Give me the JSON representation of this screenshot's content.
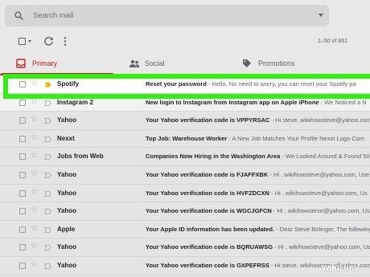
{
  "search": {
    "placeholder": "Search mail"
  },
  "toolbar": {
    "pager": "1–50 of 861"
  },
  "tabs": [
    {
      "label": "Primary",
      "icon": "inbox-icon",
      "active": true
    },
    {
      "label": "Social",
      "icon": "people-icon",
      "active": false
    },
    {
      "label": "Promotions",
      "icon": "tag-icon",
      "active": false
    }
  ],
  "emails": [
    {
      "sender": "Spotify",
      "subject": "Reset your password",
      "snippet": " - Hello. No need to worry, you can reset your Spotify pa",
      "important": true
    },
    {
      "sender": "Instagram 2",
      "subject": "New login to Instagram from Instagram app on Apple iPhone",
      "snippet": " - We Noticed a N",
      "important": false
    },
    {
      "sender": "Yahoo",
      "subject": "Your Yahoo verification code is VPPYRSAC",
      "snippet": " - Hi steve, wikihowsteve@yahoo.com",
      "important": false
    },
    {
      "sender": "Nexxt",
      "subject": "Top Job: Warehouse Worker",
      "snippet": " - A New Job Matches Your Profile Nexxt Logo Com",
      "important": false
    },
    {
      "sender": "Jobs from Web",
      "subject": "Companies Now Hiring in the Washington Area",
      "snippet": " - We Looked Around & Found 500",
      "important": false
    },
    {
      "sender": "Yahoo",
      "subject": "Your Yahoo verification code is FJAFFXBK",
      "snippet": " - Hi , wikihowsteve@yahoo.com, Use",
      "important": false
    },
    {
      "sender": "Yahoo",
      "subject": "Your Yahoo verification code is HVFZDCXN",
      "snippet": " - Hi , wikihowsteve@yahoo.com, Us",
      "important": false
    },
    {
      "sender": "Yahoo",
      "subject": "Your Yahoo verification code is WGCJGFCN",
      "snippet": " - Hi , wikihowsteve@yahoo.com, Us",
      "important": false
    },
    {
      "sender": "Apple",
      "subject": "Your Apple ID information has been updated.",
      "snippet": " - Dear Steve Bolinger, The following",
      "important": false
    },
    {
      "sender": "Yahoo",
      "subject": "Your Yahoo verification code is BQRUAWSG",
      "snippet": " - Hi , wikihowsteve@yahoo.com, Use",
      "important": false
    },
    {
      "sender": "Yahoo",
      "subject": "Your Yahoo verification code is GXPEFRSS",
      "snippet": " - Hi steve, wikihowsteve@yahoo.com",
      "important": false
    }
  ],
  "watermark": {
    "wiki": "wiki",
    "how": "How"
  },
  "colors": {
    "accent": "#c5221f",
    "highlight": "#33ee11",
    "important": "#f4b400"
  }
}
